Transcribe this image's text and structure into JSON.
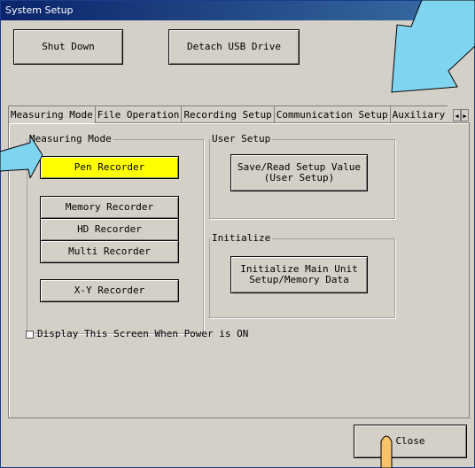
{
  "window": {
    "title": "System Setup"
  },
  "top_buttons": {
    "shut_down": "Shut Down",
    "detach_usb": "Detach USB Drive"
  },
  "tabs": [
    {
      "label": "Measuring Mode",
      "active": true
    },
    {
      "label": "File Operation",
      "active": false
    },
    {
      "label": "Recording Setup",
      "active": false
    },
    {
      "label": "Communication Setup",
      "active": false
    },
    {
      "label": "Auxiliary Setup",
      "active": false
    }
  ],
  "measuring_mode": {
    "legend": "Measuring Mode",
    "buttons": {
      "pen": "Pen Recorder",
      "memory": "Memory Recorder",
      "hd": "HD Recorder",
      "multi": "Multi Recorder",
      "xy": "X-Y Recorder"
    },
    "selected": "Pen Recorder",
    "selected_color": "#ffff00"
  },
  "user_setup": {
    "legend": "User Setup",
    "button": "Save/Read Setup Value\n(User Setup)"
  },
  "initialize": {
    "legend": "Initialize",
    "button": "Initialize Main Unit\nSetup/Memory Data"
  },
  "display_on_power": {
    "label": "Display This Screen When Power is ON",
    "checked": false
  },
  "close_button": "Close",
  "colors": {
    "callout_fill": "#7fd4f0",
    "callout_fill_orange": "#f9c36b"
  }
}
